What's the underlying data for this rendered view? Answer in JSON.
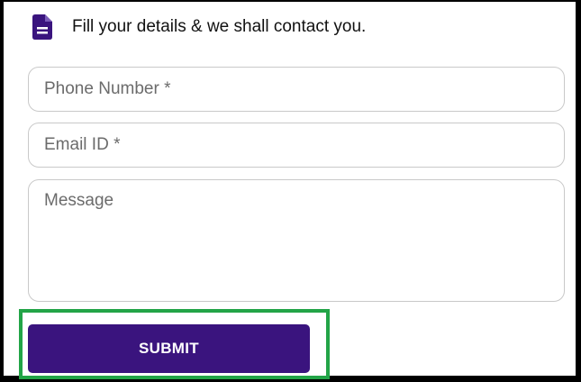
{
  "header": {
    "text": "Fill your details & we shall contact you.",
    "icon": "document-icon",
    "icon_color": "#3a147e"
  },
  "form": {
    "phone_placeholder": "Phone Number *",
    "email_placeholder": "Email ID *",
    "message_placeholder": "Message",
    "submit_label": "SUBMIT"
  },
  "colors": {
    "accent": "#3a147e",
    "highlight_border": "#22a447"
  }
}
